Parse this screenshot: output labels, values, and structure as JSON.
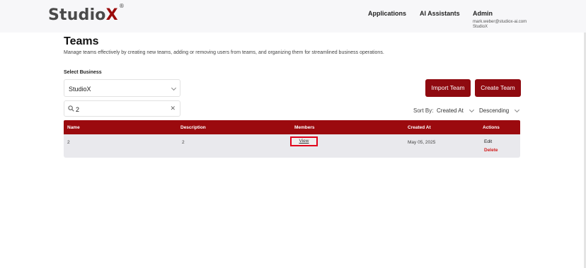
{
  "header": {
    "logo_main": "Studio",
    "logo_x": "X",
    "logo_mark": "®",
    "nav": [
      "Applications",
      "AI Assistants"
    ],
    "user": {
      "name": "Admin",
      "email": "mark.weber@studiox-ai.com",
      "org": "StudioX"
    }
  },
  "page": {
    "title": "Teams",
    "description": "Manage teams effectively by creating new teams, adding or removing users from teams, and organizing them for streamlined business operations."
  },
  "business_select": {
    "label": "Select Business",
    "value": "StudioX"
  },
  "search": {
    "value": "2"
  },
  "buttons": {
    "import": "Import Team",
    "create": "Create Team"
  },
  "sort": {
    "label": "Sort By:",
    "field": "Created At",
    "direction": "Descending"
  },
  "table": {
    "columns": [
      "Name",
      "Description",
      "Members",
      "Created At",
      "Actions"
    ],
    "rows": [
      {
        "name": "2",
        "description": "2",
        "members": "View",
        "created_at": "May 05, 2025",
        "edit": "Edit",
        "delete": "Delete"
      }
    ]
  },
  "colors": {
    "accent": "#9b0a0e",
    "highlight": "#e0001a",
    "delete": "#d11a1a"
  }
}
